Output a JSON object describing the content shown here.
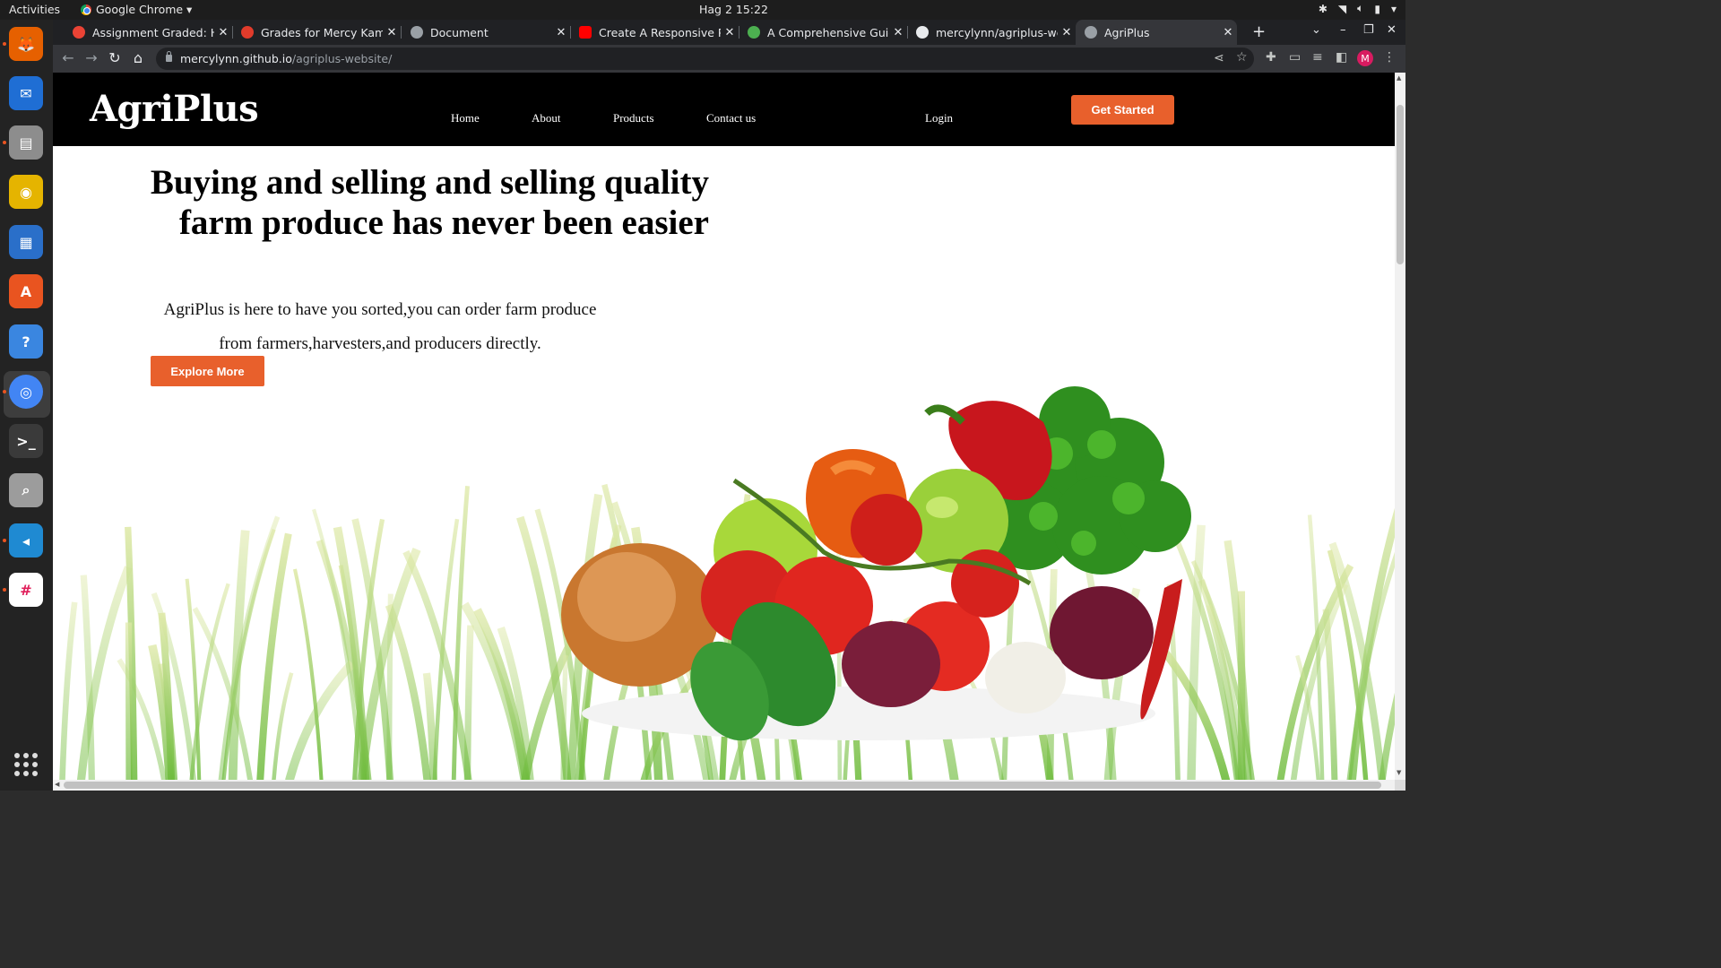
{
  "system": {
    "activities": "Activities",
    "app_menu": "Google Chrome ▾",
    "clock": "Hag 2  15:22"
  },
  "dock": {
    "apps": [
      {
        "name": "firefox",
        "color": "#e66000"
      },
      {
        "name": "thunderbird",
        "color": "#1f6ed4"
      },
      {
        "name": "files",
        "color": "#8d8d8d"
      },
      {
        "name": "rhythmbox",
        "color": "#e5b400"
      },
      {
        "name": "libreoffice-writer",
        "color": "#2a6fc9"
      },
      {
        "name": "ubuntu-software",
        "color": "#e95420"
      },
      {
        "name": "help",
        "color": "#3a86e0"
      },
      {
        "name": "chrome",
        "color": "#4285f4"
      },
      {
        "name": "terminal",
        "color": "#3a3a3a"
      },
      {
        "name": "search",
        "color": "#9c9c9c"
      },
      {
        "name": "vscode",
        "color": "#1f8ad2"
      },
      {
        "name": "slack",
        "color": "#ffffff"
      }
    ]
  },
  "browser": {
    "tabs": [
      {
        "title": "Assignment Graded: HTML",
        "icon": "gmail-icon",
        "active": false
      },
      {
        "title": "Grades for Mercy Kamene",
        "icon": "canvas-icon",
        "active": false
      },
      {
        "title": "Document",
        "icon": "globe-icon",
        "active": false
      },
      {
        "title": "Create A Responsive PERSONAL",
        "icon": "youtube-icon",
        "active": false
      },
      {
        "title": "A Comprehensive Guide",
        "icon": "leaf-icon",
        "active": false
      },
      {
        "title": "mercylynn/agriplus-website",
        "icon": "github-icon",
        "active": false
      },
      {
        "title": "AgriPlus",
        "icon": "globe-icon",
        "active": true
      }
    ],
    "url_host": "mercylynn.github.io",
    "url_path": "/agriplus-website/",
    "profile_initial": "M"
  },
  "site": {
    "logo": "AgriPlus",
    "nav": [
      "Home",
      "About",
      "Products",
      "Contact us"
    ],
    "login": "Login",
    "cta": "Get Started",
    "hero": {
      "title": "Buying and selling and selling quality farm produce has never been easier",
      "text": "AgriPlus is here to have you sorted,you can order farm produce from farmers,harvesters,and producers directly.",
      "button": "Explore More"
    },
    "colors": {
      "accent": "#e8602c",
      "header": "#000000"
    }
  }
}
